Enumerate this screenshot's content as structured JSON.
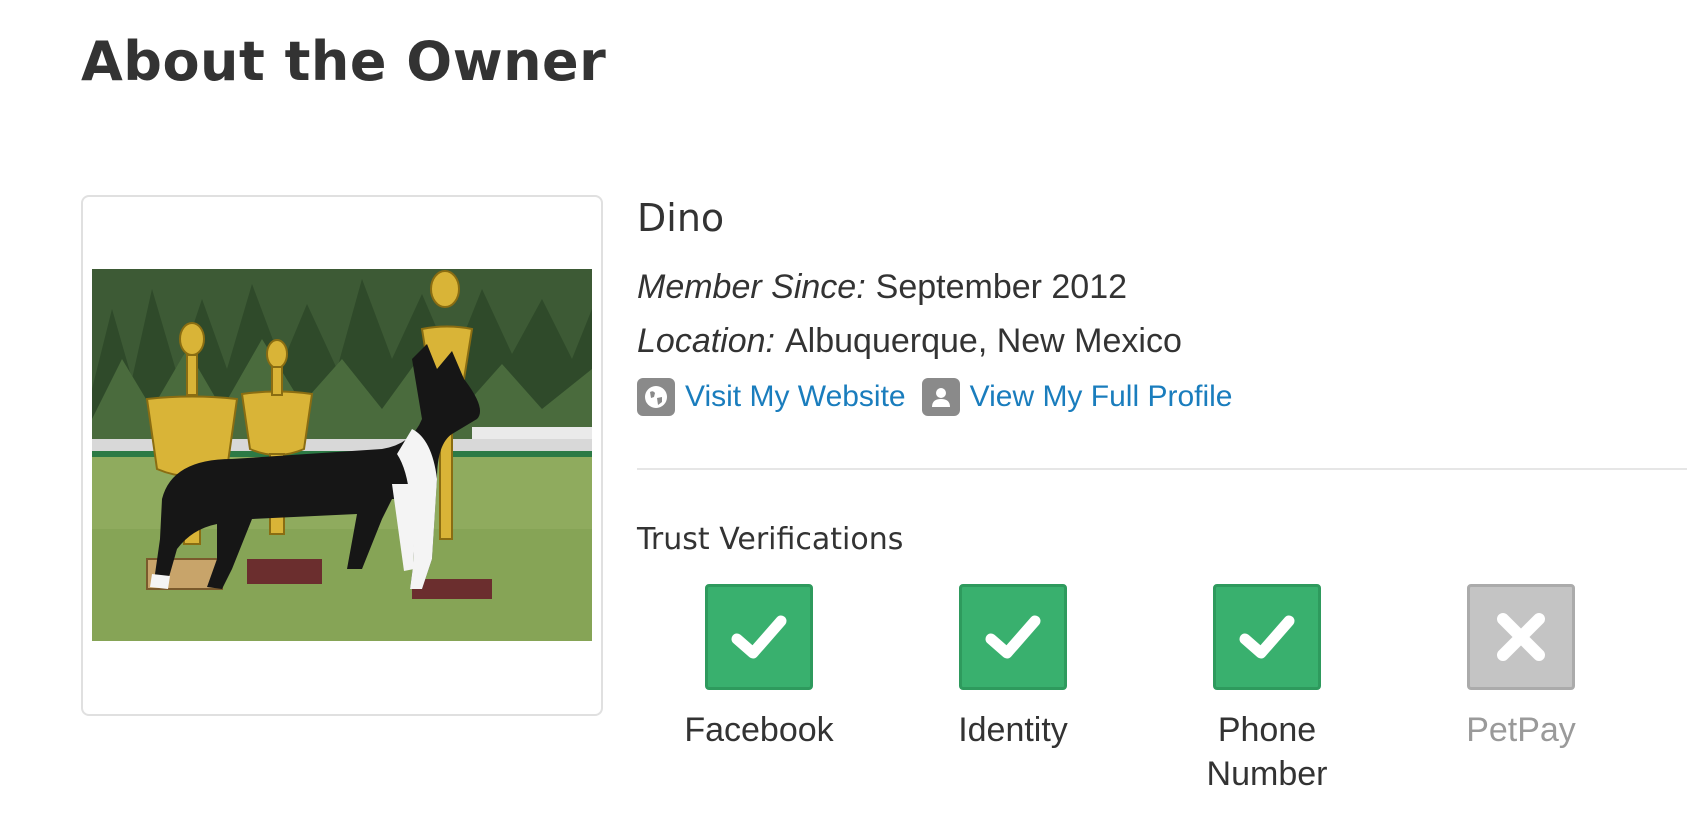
{
  "section": {
    "title": "About the Owner"
  },
  "owner": {
    "name": "Dino",
    "member_since_label": "Member Since:",
    "member_since_value": "September 2012",
    "location_label": "Location:",
    "location_value": "Albuquerque, New Mexico",
    "photo_icon": "dog-with-trophies-photo"
  },
  "links": {
    "website": {
      "label": "Visit My Website",
      "icon": "globe-icon"
    },
    "profile": {
      "label": "View My Full Profile",
      "icon": "user-icon"
    },
    "color": "#1a7dbd"
  },
  "trust": {
    "title": "Trust Verifications",
    "items": [
      {
        "label": "Facebook",
        "verified": true,
        "icon": "check-icon"
      },
      {
        "label": "Identity",
        "verified": true,
        "icon": "check-icon"
      },
      {
        "label": "Phone Number",
        "verified": true,
        "icon": "check-icon"
      },
      {
        "label": "PetPay",
        "verified": false,
        "icon": "x-icon"
      }
    ],
    "verified_color": "#39b06e",
    "unverified_color": "#c4c4c4"
  }
}
